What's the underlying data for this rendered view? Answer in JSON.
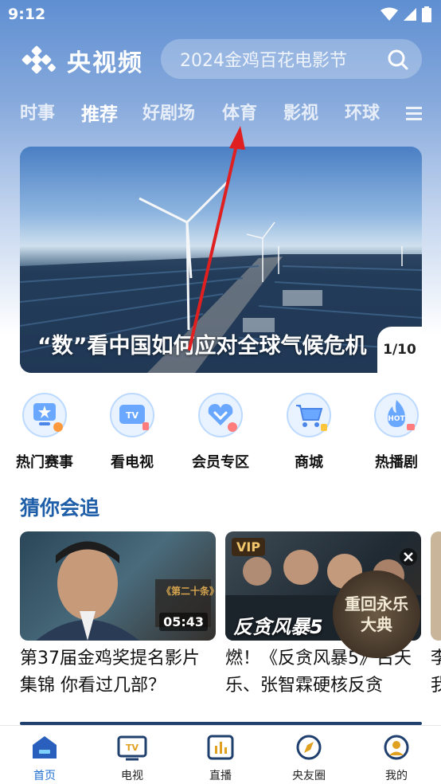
{
  "status_bar": {
    "time": "9:12"
  },
  "header": {
    "app_name": "央视频",
    "search_placeholder": "2024金鸡百花电影节"
  },
  "tabs": [
    {
      "label": "时事"
    },
    {
      "label": "推荐",
      "active": true
    },
    {
      "label": "好剧场"
    },
    {
      "label": "体育"
    },
    {
      "label": "影视"
    },
    {
      "label": "环球"
    }
  ],
  "banner": {
    "title": "“数”看中国如何应对全球气候危机",
    "counter": "1/10"
  },
  "quick_entries": [
    {
      "label": "热门赛事",
      "icon": "trophy-icon"
    },
    {
      "label": "看电视",
      "icon": "tv-icon"
    },
    {
      "label": "会员专区",
      "icon": "vip-heart-icon"
    },
    {
      "label": "商城",
      "icon": "cart-icon"
    },
    {
      "label": "热播剧",
      "icon": "hot-icon"
    }
  ],
  "section": {
    "title": "猜你会追"
  },
  "cards": [
    {
      "caption_line1": "第37届金鸡奖提名影片",
      "caption_line2": "集锦 你看过几部？",
      "duration": "05:43",
      "overlay_text": "《第二十条》"
    },
    {
      "caption_line1": "燃！《反贪风暴5》古天",
      "caption_line2": "乐、张智霖硬核反贪",
      "badge": "VIP",
      "overlay_text": "反贪风暴5",
      "floating_ad": "重回永乐大典"
    },
    {
      "caption_line1": "李",
      "caption_line2": "我"
    }
  ],
  "bottom_nav": [
    {
      "label": "首页",
      "active": true,
      "icon": "home-icon"
    },
    {
      "label": "电视",
      "icon": "tv-icon"
    },
    {
      "label": "直播",
      "icon": "live-icon"
    },
    {
      "label": "央友圈",
      "icon": "compass-icon"
    },
    {
      "label": "我的",
      "icon": "profile-icon"
    }
  ],
  "colors": {
    "accent": "#1f6fd1",
    "section_title": "#1f5ea8",
    "annotation_arrow": "#e02020"
  }
}
